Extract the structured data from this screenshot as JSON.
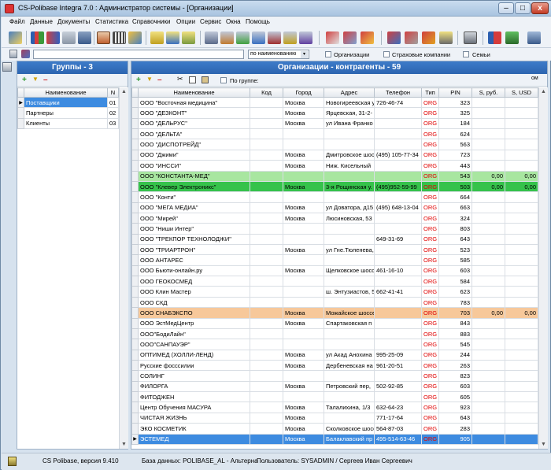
{
  "window": {
    "title": "CS-Polibase Integra 7.0 : Администратор системы - [Организации]",
    "minimize": "–",
    "maximize": "□",
    "close": "x"
  },
  "menu": [
    "Файл",
    "Данные",
    "Документы",
    "Статистика",
    "Справочники",
    "Опции",
    "Сервис",
    "Окна",
    "Помощь"
  ],
  "search": {
    "value": "",
    "sort_select": "по наименованию",
    "filter_orgs": "Организации",
    "filter_insurance": "Страховые компании",
    "filter_families": "Семьи"
  },
  "groups_panel": {
    "title": "Группы - 3",
    "columns": [
      "Наименование",
      "N"
    ],
    "rows": [
      {
        "name": "Поставщики",
        "n": "01"
      },
      {
        "name": "Партнеры",
        "n": "02"
      },
      {
        "name": "Клиенты",
        "n": "03"
      }
    ]
  },
  "orgs_panel": {
    "title": "Организации - контрагенты - 59",
    "by_group_label": "По группе:",
    "by_group_value": "",
    "columns": [
      "Наименование",
      "Код",
      "Город",
      "Адрес",
      "Телефон",
      "Тип",
      "PIN",
      "S, руб.",
      "S, USD"
    ],
    "rows": [
      {
        "name": "ООО \"Восточная медицина\"",
        "code": "",
        "city": "Москва",
        "address": "Новогиреевская ул, д.",
        "phone": "726-46-74",
        "type": "ORG",
        "pin": "323",
        "s_rub": "",
        "s_usd": ""
      },
      {
        "name": "ООО \"ДЕЗКОНТ\"",
        "code": "",
        "city": "Москва",
        "address": "Ярцевская, 31-2-",
        "phone": "",
        "type": "ORG",
        "pin": "325",
        "s_rub": "",
        "s_usd": ""
      },
      {
        "name": "ООО \"ДЕЛЬРУС\"",
        "code": "",
        "city": "Москва",
        "address": "ул Ивана Франко",
        "phone": "",
        "type": "ORG",
        "pin": "184",
        "s_rub": "",
        "s_usd": ""
      },
      {
        "name": "ООО \"ДЕЛЬТА\"",
        "code": "",
        "city": "",
        "address": "",
        "phone": "",
        "type": "ORG",
        "pin": "624",
        "s_rub": "",
        "s_usd": ""
      },
      {
        "name": "ООО \"ДИСПОТРЕЙД\"",
        "code": "",
        "city": "",
        "address": "",
        "phone": "",
        "type": "ORG",
        "pin": "563",
        "s_rub": "",
        "s_usd": ""
      },
      {
        "name": "ООО \"Джими\"",
        "code": "",
        "city": "Москва",
        "address": "Дмитровское шоссе",
        "phone": "(495) 105-77-34",
        "type": "ORG",
        "pin": "723",
        "s_rub": "",
        "s_usd": ""
      },
      {
        "name": "ООО \"ИНССИ\"",
        "code": "",
        "city": "Москва",
        "address": "Ниж. Кисельный",
        "phone": "",
        "type": "ORG",
        "pin": "443",
        "s_rub": "",
        "s_usd": ""
      },
      {
        "name": "ООО \"КОНСТАНТА-МЕД\"",
        "code": "",
        "city": "",
        "address": "",
        "phone": "",
        "type": "ORG",
        "pin": "543",
        "s_rub": "0,00",
        "s_usd": "0,00",
        "style": "green"
      },
      {
        "name": "ООО \"Клевер Электроникс\"",
        "code": "",
        "city": "Москва",
        "address": "3-я Рощинская у.",
        "phone": "(495)952-59-99",
        "type": "ORG",
        "pin": "503",
        "s_rub": "0,00",
        "s_usd": "0,00",
        "style": "green2"
      },
      {
        "name": "ООО \"Конти\"",
        "code": "",
        "city": "",
        "address": "",
        "phone": "",
        "type": "ORG",
        "pin": "664",
        "s_rub": "",
        "s_usd": ""
      },
      {
        "name": "ООО \"МЕГА МЕДИА\"",
        "code": "",
        "city": "Москва",
        "address": "ул Доватора, д15",
        "phone": "(495) 648-13-04",
        "type": "ORG",
        "pin": "663",
        "s_rub": "",
        "s_usd": ""
      },
      {
        "name": "ООО \"Мирей\"",
        "code": "",
        "city": "Москва",
        "address": "Люсиновская, 53",
        "phone": "",
        "type": "ORG",
        "pin": "324",
        "s_rub": "",
        "s_usd": ""
      },
      {
        "name": "ООО \"Ниши Интер\"",
        "code": "",
        "city": "",
        "address": "",
        "phone": "",
        "type": "ORG",
        "pin": "803",
        "s_rub": "",
        "s_usd": ""
      },
      {
        "name": "ООО \"ТРЕКПОР ТЕХНОЛОДЖИ\"",
        "code": "",
        "city": "",
        "address": "",
        "phone": "649-31-69",
        "type": "ORG",
        "pin": "643",
        "s_rub": "",
        "s_usd": ""
      },
      {
        "name": "ООО \"ТРИАРТРОН\"",
        "code": "",
        "city": "Москва",
        "address": "ул Гне.Тюленева,",
        "phone": "",
        "type": "ORG",
        "pin": "523",
        "s_rub": "",
        "s_usd": ""
      },
      {
        "name": "ООО АНТАРЕС",
        "code": "",
        "city": "",
        "address": "",
        "phone": "",
        "type": "ORG",
        "pin": "585",
        "s_rub": "",
        "s_usd": ""
      },
      {
        "name": "ООО Бьюти-онлайн.ру",
        "code": "",
        "city": "Москва",
        "address": "Щелковское шоссе",
        "phone": "461-16-10",
        "type": "ORG",
        "pin": "603",
        "s_rub": "",
        "s_usd": ""
      },
      {
        "name": "ООО ГЕОКОСМЕД",
        "code": "",
        "city": "",
        "address": "",
        "phone": "",
        "type": "ORG",
        "pin": "584",
        "s_rub": "",
        "s_usd": ""
      },
      {
        "name": "ООО Клин Мастер",
        "code": "",
        "city": "",
        "address": "ш. Энтузиастов, 5",
        "phone": "662-41-41",
        "type": "ORG",
        "pin": "623",
        "s_rub": "",
        "s_usd": ""
      },
      {
        "name": "ООО СКД",
        "code": "",
        "city": "",
        "address": "",
        "phone": "",
        "type": "ORG",
        "pin": "783",
        "s_rub": "",
        "s_usd": ""
      },
      {
        "name": "ООО СНАБЭКСПО",
        "code": "",
        "city": "Москва",
        "address": "Можайское шоссе",
        "phone": "",
        "type": "ORG",
        "pin": "703",
        "s_rub": "0,00",
        "s_usd": "0,00",
        "style": "orange"
      },
      {
        "name": "ООО ЭстМедЦентр",
        "code": "",
        "city": "Москва",
        "address": "Спартаковская п",
        "phone": "",
        "type": "ORG",
        "pin": "843",
        "s_rub": "",
        "s_usd": ""
      },
      {
        "name": "ООО\"БодиЛайн\"",
        "code": "",
        "city": "",
        "address": "",
        "phone": "",
        "type": "ORG",
        "pin": "883",
        "s_rub": "",
        "s_usd": ""
      },
      {
        "name": "ООО\"САНПАУЭР\"",
        "code": "",
        "city": "",
        "address": "",
        "phone": "",
        "type": "ORG",
        "pin": "545",
        "s_rub": "",
        "s_usd": ""
      },
      {
        "name": "ОПТИМЕД (ХОЛЛИ-ЛЕНД)",
        "code": "",
        "city": "Москва",
        "address": "ул Акад Анохина",
        "phone": "995-25-09",
        "type": "ORG",
        "pin": "244",
        "s_rub": "",
        "s_usd": ""
      },
      {
        "name": "Русские фосссилии",
        "code": "",
        "city": "Москва",
        "address": "Дербеневская на",
        "phone": "961-20-51",
        "type": "ORG",
        "pin": "263",
        "s_rub": "",
        "s_usd": ""
      },
      {
        "name": "СОЛИНГ",
        "code": "",
        "city": "",
        "address": "",
        "phone": "",
        "type": "ORG",
        "pin": "823",
        "s_rub": "",
        "s_usd": ""
      },
      {
        "name": "ФИЛОРГА",
        "code": "",
        "city": "Москва",
        "address": "Петровский пер,",
        "phone": "502-92-85",
        "type": "ORG",
        "pin": "603",
        "s_rub": "",
        "s_usd": ""
      },
      {
        "name": "ФИТОДЖЕН",
        "code": "",
        "city": "",
        "address": "",
        "phone": "",
        "type": "ORG",
        "pin": "605",
        "s_rub": "",
        "s_usd": ""
      },
      {
        "name": "Центр Обучения МАСУРА",
        "code": "",
        "city": "Москва",
        "address": "Талалихина, 1/3",
        "phone": "632-64-23",
        "type": "ORG",
        "pin": "923",
        "s_rub": "",
        "s_usd": ""
      },
      {
        "name": "ЧИСТАЯ ЖИЗНЬ",
        "code": "",
        "city": "Москва",
        "address": "",
        "phone": "771-17-64",
        "type": "ORG",
        "pin": "643",
        "s_rub": "",
        "s_usd": ""
      },
      {
        "name": "ЭКО КОСМЕТИК",
        "code": "",
        "city": "Москва",
        "address": "Сколковское шосс",
        "phone": "564-87-03",
        "type": "ORG",
        "pin": "283",
        "s_rub": "",
        "s_usd": ""
      },
      {
        "name": "ЭСТЕМЕД",
        "code": "",
        "city": "Москва",
        "address": "Балаклавский пр",
        "phone": "495-514-63-46",
        "type": "ORG",
        "pin": "905",
        "s_rub": "",
        "s_usd": "",
        "style": "cur"
      }
    ]
  },
  "status": {
    "version": "CS Polibase, версия 9.410",
    "database": "База данных: POLIBASE_AL - Альтерна",
    "user": "Пользователь: SYSADMIN / Сергеев Иван Сергеевич"
  },
  "colors": {
    "panel_header": "#2d65b0",
    "row_green": "#a8e6a0",
    "row_green_dark": "#35c24b",
    "row_orange": "#f7c89a",
    "row_selected": "#3d8be0",
    "org_type": "#e00000"
  }
}
